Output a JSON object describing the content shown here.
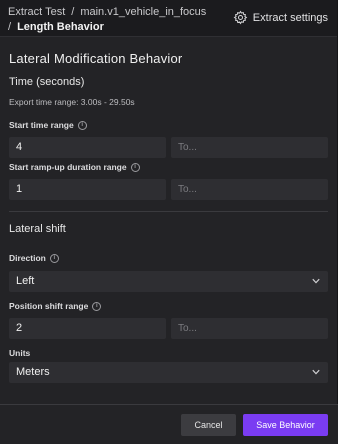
{
  "header": {
    "breadcrumb_1": "Extract Test",
    "breadcrumb_2": "main.v1_vehicle_in_focus",
    "breadcrumb_3": "Length Behavior",
    "settings_label": "Extract settings"
  },
  "main": {
    "title": "Lateral Modification Behavior",
    "time_section": {
      "heading": "Time (seconds)",
      "export_range": "Export time range: 3.00s - 29.50s",
      "start_time": {
        "label": "Start time range",
        "from_value": "4",
        "to_placeholder": "To..."
      },
      "ramp_up": {
        "label": "Start ramp-up duration range",
        "from_value": "1",
        "to_placeholder": "To..."
      }
    },
    "shift_section": {
      "heading": "Lateral shift",
      "direction": {
        "label": "Direction",
        "value": "Left"
      },
      "position": {
        "label": "Position shift range",
        "from_value": "2",
        "to_placeholder": "To..."
      },
      "units": {
        "label": "Units",
        "value": "Meters"
      }
    }
  },
  "footer": {
    "cancel_label": "Cancel",
    "save_label": "Save Behavior"
  },
  "colors": {
    "accent": "#7a3cf2",
    "background": "#232326",
    "input_bg": "#2e2e32"
  },
  "icons": {
    "settings": "gear-icon",
    "info": "info-icon",
    "dropdown": "chevron-down-icon"
  }
}
